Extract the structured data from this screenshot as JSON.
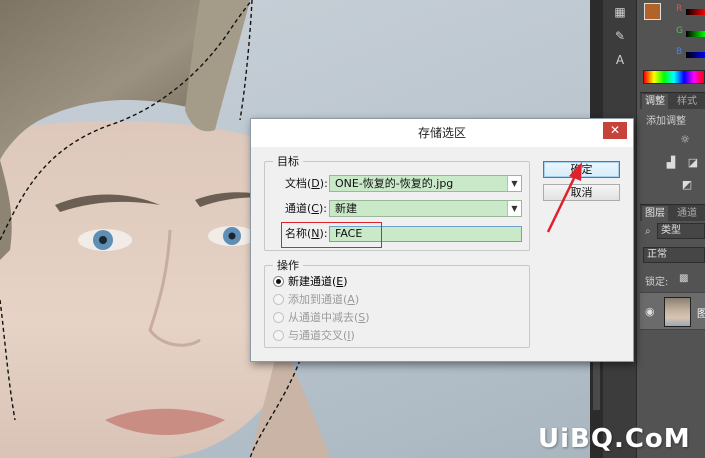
{
  "dialog": {
    "title": "存储选区",
    "target_group": "目标",
    "document_label_pre": "文档(",
    "document_label_key": "D",
    "document_label_post": "):",
    "document_value": "ONE-恢复的-恢复的.jpg",
    "channel_label_pre": "通道(",
    "channel_label_key": "C",
    "channel_label_post": "):",
    "channel_value": "新建",
    "name_label_pre": "名称(",
    "name_label_key": "N",
    "name_label_post": "):",
    "name_value": "FACE",
    "operation_group": "操作",
    "operations": [
      {
        "pre": "新建通道(",
        "key": "E",
        "post": ")",
        "checked": true,
        "enabled": true
      },
      {
        "pre": "添加到通道(",
        "key": "A",
        "post": ")",
        "checked": false,
        "enabled": false
      },
      {
        "pre": "从通道中减去(",
        "key": "S",
        "post": ")",
        "checked": false,
        "enabled": false
      },
      {
        "pre": "与通道交叉(",
        "key": "I",
        "post": ")",
        "checked": false,
        "enabled": false
      }
    ],
    "ok_label": "确定",
    "cancel_label": "取消",
    "close_glyph": "✕"
  },
  "panels": {
    "color_channels": [
      "R",
      "G",
      "B"
    ],
    "colors": {
      "foreground": "#b0642a",
      "background": "#ffffff"
    },
    "adjust_tab": "调整",
    "style_tab": "样式",
    "add_adjustment": "添加调整",
    "layers_tab": "图层",
    "channels_tab": "通道",
    "kind_filter": "类型",
    "blend_mode": "正常",
    "lock_label": "锁定:",
    "layer_label_char": "图"
  },
  "watermark": "UiBQ.CoM"
}
